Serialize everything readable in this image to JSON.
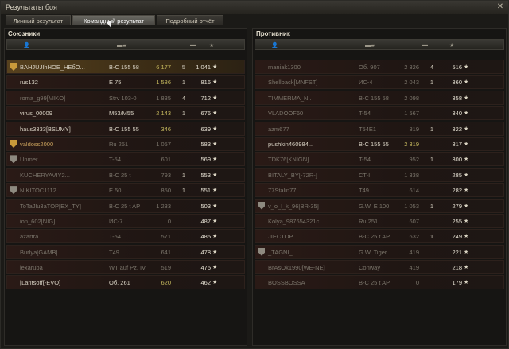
{
  "window": {
    "title": "Результаты боя"
  },
  "tabs": [
    {
      "label": "Личный результат",
      "active": false
    },
    {
      "label": "Командный результат",
      "active": true
    },
    {
      "label": "Подробный отчёт",
      "active": false
    }
  ],
  "allies": {
    "title": "Союзники",
    "rows": [
      {
        "player": "BAHJUJIhHOE_HEбO...",
        "tank": "B-C 155 58",
        "damage": "6 177",
        "frags": "5",
        "xp": "1 041",
        "me": true,
        "badge": "gold",
        "dead": false
      },
      {
        "player": "rus132",
        "tank": "E 75",
        "damage": "1 586",
        "frags": "1",
        "xp": "816",
        "dead": false
      },
      {
        "player": "roma_g99[MIKO]",
        "tank": "Strv 103-0",
        "damage": "1 835",
        "frags": "4",
        "xp": "712",
        "dead": true
      },
      {
        "player": "virus_00009",
        "tank": "M53/M55",
        "damage": "2 143",
        "frags": "1",
        "xp": "676",
        "dead": false
      },
      {
        "player": "haus3333[BSUMY]",
        "tank": "B-C 155 55",
        "damage": "346",
        "frags": "",
        "xp": "639",
        "dead": false
      },
      {
        "player": "valdoss2000",
        "tank": "Ru 251",
        "damage": "1 057",
        "frags": "",
        "xp": "583",
        "badge": "gold",
        "dead": true,
        "squad": true
      },
      {
        "player": "Unmer",
        "tank": "T-54",
        "damage": "601",
        "frags": "",
        "xp": "569",
        "badge": "grey",
        "dead": true
      },
      {
        "player": "KUCHERYAVIY2...",
        "tank": "B-C 25 t",
        "damage": "793",
        "frags": "1",
        "xp": "553",
        "dead": true
      },
      {
        "player": "NIKITOC1112",
        "tank": "E 50",
        "damage": "850",
        "frags": "1",
        "xp": "551",
        "badge": "grey",
        "dead": true
      },
      {
        "player": "ToTaJlu3aTOP[EX_TY]",
        "tank": "B-C 25 t AP",
        "damage": "1 233",
        "frags": "",
        "xp": "503",
        "dead": true
      },
      {
        "player": "ion_602[NIG]",
        "tank": "ИС-7",
        "damage": "0",
        "frags": "",
        "xp": "487",
        "dead": true
      },
      {
        "player": "azartra",
        "tank": "T-54",
        "damage": "571",
        "frags": "",
        "xp": "485",
        "dead": true
      },
      {
        "player": "Burlya[GAMB]",
        "tank": "T49",
        "damage": "641",
        "frags": "",
        "xp": "478",
        "dead": true
      },
      {
        "player": "lexaruba",
        "tank": "WT auf Pz. IV",
        "damage": "519",
        "frags": "",
        "xp": "475",
        "dead": true
      },
      {
        "player": "[Lantsoff[-EVO]",
        "tank": "Об. 261",
        "damage": "620",
        "frags": "",
        "xp": "462",
        "dead": false
      }
    ]
  },
  "enemies": {
    "title": "Противник",
    "rows": [
      {
        "player": "maniak1300",
        "tank": "Об. 907",
        "damage": "2 326",
        "frags": "4",
        "xp": "516",
        "dead": true
      },
      {
        "player": "Shellback[MNFST]",
        "tank": "ИС-4",
        "damage": "2 043",
        "frags": "1",
        "xp": "360",
        "dead": true
      },
      {
        "player": "TIMMERMA_N..",
        "tank": "B-C 155 58",
        "damage": "2 098",
        "frags": "",
        "xp": "358",
        "dead": true
      },
      {
        "player": "VLADOOF60",
        "tank": "T-54",
        "damage": "1 567",
        "frags": "",
        "xp": "340",
        "dead": true
      },
      {
        "player": "azm677",
        "tank": "T54E1",
        "damage": "819",
        "frags": "1",
        "xp": "322",
        "dead": true
      },
      {
        "player": "pushkin460984...",
        "tank": "B-C 155 55",
        "damage": "2 319",
        "frags": "",
        "xp": "317",
        "dead": false
      },
      {
        "player": "TDK76[KNIGN]",
        "tank": "T-54",
        "damage": "952",
        "frags": "1",
        "xp": "300",
        "dead": true
      },
      {
        "player": "BITALY_BY[-72R-]",
        "tank": "CT-I",
        "damage": "1 338",
        "frags": "",
        "xp": "285",
        "dead": true
      },
      {
        "player": "77Stalin77",
        "tank": "T49",
        "damage": "614",
        "frags": "",
        "xp": "282",
        "dead": true
      },
      {
        "player": "v_o_l_k_96[BR-35]",
        "tank": "G.W. E 100",
        "damage": "1 053",
        "frags": "1",
        "xp": "279",
        "badge": "grey",
        "dead": true
      },
      {
        "player": "Kolya_987654321c...",
        "tank": "Ru 251",
        "damage": "607",
        "frags": "",
        "xp": "255",
        "dead": true
      },
      {
        "player": "JIECTOP",
        "tank": "B-C 25 t AP",
        "damage": "632",
        "frags": "1",
        "xp": "249",
        "dead": true
      },
      {
        "player": "_TAGNI_",
        "tank": "G.W. Tiger",
        "damage": "419",
        "frags": "",
        "xp": "221",
        "badge": "grey",
        "dead": true
      },
      {
        "player": "BrAsOk1990[WE-NE]",
        "tank": "Conway",
        "damage": "419",
        "frags": "",
        "xp": "218",
        "dead": true
      },
      {
        "player": "BOSSBOSSA",
        "tank": "B-C 25 t AP",
        "damage": "0",
        "frags": "",
        "xp": "179",
        "dead": true
      }
    ]
  },
  "icons": {
    "close": "close-icon",
    "star": "star-icon",
    "tank": "tank-icon",
    "player": "player-icon"
  }
}
